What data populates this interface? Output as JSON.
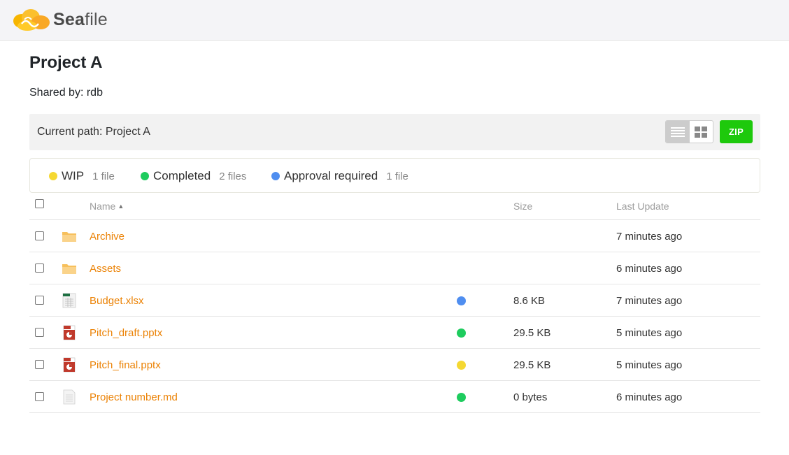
{
  "app": {
    "logo_sea": "Sea",
    "logo_file": "file"
  },
  "page": {
    "title": "Project A",
    "shared_label": "Shared by:",
    "shared_user": "rdb"
  },
  "pathbar": {
    "label": "Current path:",
    "path": "Project A",
    "zip_label": "ZIP"
  },
  "statuses": [
    {
      "name": "WIP",
      "count": "1 file",
      "color": "#f5d832"
    },
    {
      "name": "Completed",
      "count": "2 files",
      "color": "#1ecc5e"
    },
    {
      "name": "Approval required",
      "count": "1 file",
      "color": "#4f8ef0"
    }
  ],
  "table": {
    "col_name": "Name",
    "col_size": "Size",
    "col_updated": "Last Update"
  },
  "rows": [
    {
      "name": "Archive",
      "icon": "folder-icon",
      "tag_color": "",
      "size": "",
      "updated": "7 minutes ago"
    },
    {
      "name": "Assets",
      "icon": "folder-icon",
      "tag_color": "",
      "size": "",
      "updated": "6 minutes ago"
    },
    {
      "name": "Budget.xlsx",
      "icon": "excel-file-icon",
      "tag_color": "#4f8ef0",
      "size": "8.6 KB",
      "updated": "7 minutes ago"
    },
    {
      "name": "Pitch_draft.pptx",
      "icon": "powerpoint-file-icon",
      "tag_color": "#1ecc5e",
      "size": "29.5 KB",
      "updated": "5 minutes ago"
    },
    {
      "name": "Pitch_final.pptx",
      "icon": "powerpoint-file-icon",
      "tag_color": "#f5d832",
      "size": "29.5 KB",
      "updated": "5 minutes ago"
    },
    {
      "name": "Project number.md",
      "icon": "text-file-icon",
      "tag_color": "#1ecc5e",
      "size": "0 bytes",
      "updated": "6 minutes ago"
    }
  ]
}
